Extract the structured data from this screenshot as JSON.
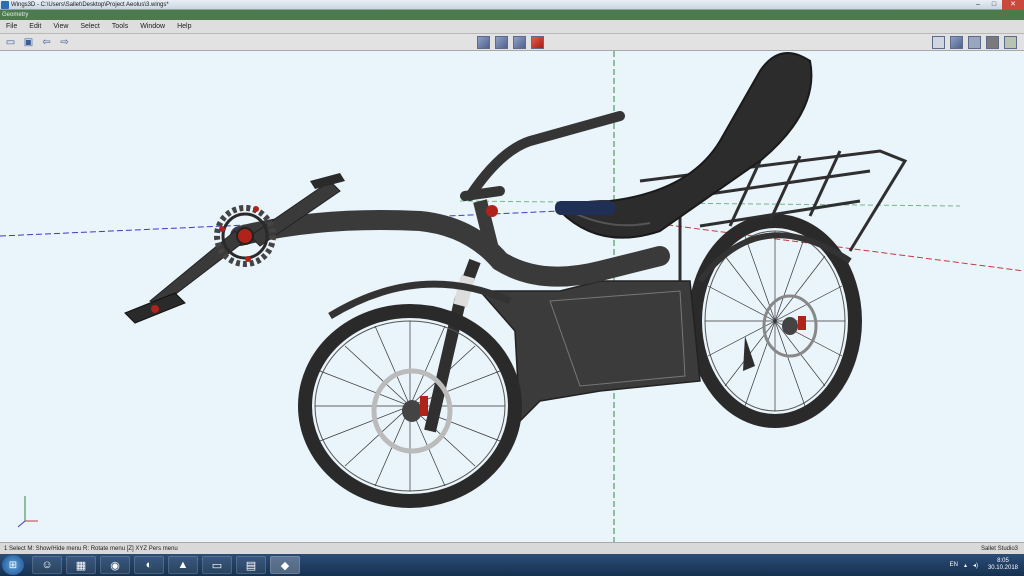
{
  "window": {
    "title": "Wings3D - C:\\Users\\Sallet\\Desktop\\Project Aeolus\\3.wings*",
    "minimize": "–",
    "maximize": "□",
    "close": "✕"
  },
  "geometry_bar": {
    "label": "Geometry"
  },
  "menu": {
    "items": [
      "File",
      "Edit",
      "View",
      "Select",
      "Tools",
      "Window",
      "Help"
    ]
  },
  "toolbar": {
    "left_icons": [
      "open-icon",
      "save-icon",
      "undo-icon",
      "redo-icon"
    ],
    "selection_modes": [
      "vertex-mode",
      "edge-mode",
      "face-mode",
      "body-mode"
    ],
    "active_mode": "body-mode",
    "right_icons": [
      "ground-plane-icon",
      "smooth-shading-icon",
      "wireframe-icon",
      "show-all-icon",
      "orthographic-icon"
    ]
  },
  "statusbar": {
    "left": "1 Select   M: Show/Hide menu   R: Rotate menu   [Z] XYZ Pers  menu",
    "right": "Sallet  Studio3"
  },
  "taskbar": {
    "start_icon": "windows-start-icon",
    "tasks": [
      "people-icon",
      "calculator-icon",
      "chrome-icon",
      "vivaldi-icon",
      "autodesk-icon",
      "folder-icon",
      "film-icon",
      "wings3d-icon"
    ],
    "active_task": "wings3d-icon",
    "language": "EN",
    "time": "8:05",
    "date": "30.10.2018"
  },
  "colors": {
    "viewport_bg": "#eaf4fb",
    "model_body": "#3a3a3a",
    "highlight_red": "#b0231a",
    "axis_green": "#2f8a3e",
    "axis_red": "#c23c3c",
    "axis_blue": "#3c3cc2"
  }
}
